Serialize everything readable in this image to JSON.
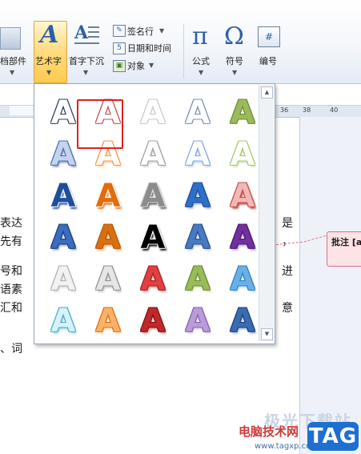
{
  "ribbon": {
    "doc_parts_label": "档部件",
    "wordart_label": "艺术字",
    "dropcap_label": "首字下沉",
    "signature_line_label": "签名行",
    "datetime_label": "日期和时间",
    "object_label": "对象",
    "equation_label": "公式",
    "symbol_label": "符号",
    "number_label": "编号"
  },
  "ruler": {
    "numbers": [
      "36",
      "38",
      "40"
    ]
  },
  "document": {
    "lines": [
      "表达",
      "先有",
      "号和",
      "语素",
      "汇和",
      "、词"
    ],
    "right_fragments": [
      "是",
      "，",
      "进",
      "意"
    ]
  },
  "comment": {
    "label": "批注 [a"
  },
  "gallery": {
    "styles": [
      {
        "glyph": "A",
        "fill": "#ffffff",
        "stroke": "#2a3f66",
        "shadow": "none"
      },
      {
        "glyph": "A",
        "fill": "#ffffff",
        "stroke": "#c0504d",
        "shadow": "none"
      },
      {
        "glyph": "A",
        "fill": "#ffffff",
        "stroke": "#c8c8c8",
        "shadow": "none"
      },
      {
        "glyph": "A",
        "fill": "#ffffff",
        "stroke": "#7a8fb0",
        "shadow": "none"
      },
      {
        "glyph": "A",
        "fill": "#9bbb59",
        "stroke": "#6a8a35",
        "shadow": "none"
      },
      {
        "glyph": "A",
        "fill": "#c5d3ee",
        "stroke": "#4f6fb0",
        "shadow": "#8ea3cf"
      },
      {
        "glyph": "A",
        "fill": "#ffffff",
        "stroke": "#f79646",
        "shadow": "#fbd5b5"
      },
      {
        "glyph": "A",
        "fill": "#ffffff",
        "stroke": "#a0a0a0",
        "shadow": "#d8d8d8"
      },
      {
        "glyph": "A",
        "fill": "#ffffff",
        "stroke": "#7ea9d8",
        "shadow": "#c6d9f0"
      },
      {
        "glyph": "A",
        "fill": "#ffffff",
        "stroke": "#a8c86a",
        "shadow": "#d7e4bd"
      },
      {
        "glyph": "A",
        "fill": "#1f4e9c",
        "stroke": "#ffffff",
        "shadow": "#1f4e9c"
      },
      {
        "glyph": "A",
        "fill": "#e46c0a",
        "stroke": "#ffffff",
        "shadow": "#e46c0a"
      },
      {
        "glyph": "A",
        "fill": "#8c8c8c",
        "stroke": "#d9d9d9",
        "shadow": "#595959"
      },
      {
        "glyph": "A",
        "fill": "#2e6fc7",
        "stroke": "#1f4e9c",
        "shadow": "#9dbde8"
      },
      {
        "glyph": "A",
        "fill": "#f2b8b7",
        "stroke": "#c0504d",
        "shadow": "#c0504d"
      },
      {
        "glyph": "A",
        "fill": "#3a6cc0",
        "stroke": "#1f3f7a",
        "shadow": "#9db4dd"
      },
      {
        "glyph": "A",
        "fill": "#d9700f",
        "stroke": "#b4560a",
        "shadow": "#f0b070"
      },
      {
        "glyph": "A",
        "fill": "#000000",
        "stroke": "#ffffff",
        "shadow": "#000000"
      },
      {
        "glyph": "A",
        "fill": "#4a79c4",
        "stroke": "#284f8f",
        "shadow": "#c0d2ee"
      },
      {
        "glyph": "A",
        "fill": "#7030a0",
        "stroke": "#4b1a72",
        "shadow": "#c9b0e0"
      },
      {
        "glyph": "A",
        "fill": "#f2f2f2",
        "stroke": "#b0b0b0",
        "shadow": "#dcdcdc"
      },
      {
        "glyph": "A",
        "fill": "#e6e6e6",
        "stroke": "#909090",
        "shadow": "#c8c8c8"
      },
      {
        "glyph": "A",
        "fill": "#e04040",
        "stroke": "#a82020",
        "shadow": "#f2a0a0"
      },
      {
        "glyph": "A",
        "fill": "#9bbb59",
        "stroke": "#6a8a35",
        "shadow": "#d7e4bd"
      },
      {
        "glyph": "A",
        "fill": "#6ab0e8",
        "stroke": "#2f7fc0",
        "shadow": "#bfe0f7"
      },
      {
        "glyph": "A",
        "fill": "#d6f2f8",
        "stroke": "#4bacc6",
        "shadow": "#a6dcea"
      },
      {
        "glyph": "A",
        "fill": "#f8b36a",
        "stroke": "#e46c0a",
        "shadow": "#fde0c0"
      },
      {
        "glyph": "A",
        "fill": "#c0282a",
        "stroke": "#7a1214",
        "shadow": "#e8a0a0"
      },
      {
        "glyph": "A",
        "fill": "#b99cd8",
        "stroke": "#8060b0",
        "shadow": "#e2d4f0"
      },
      {
        "glyph": "A",
        "fill": "#3a6cb0",
        "stroke": "#1f3f7a",
        "shadow": "#a8c0e0"
      }
    ],
    "selected_index": 1
  },
  "watermark": {
    "line1": "极光下载站",
    "line2": "电脑技术网",
    "line3": "www.tagxp.com",
    "tag": "TAG"
  }
}
